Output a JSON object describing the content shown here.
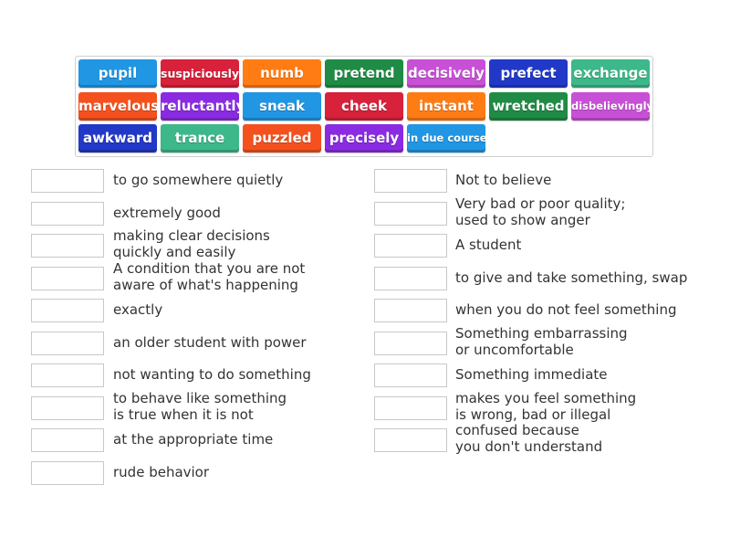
{
  "word_bank": [
    {
      "label": "pupil",
      "color": "#2196e3"
    },
    {
      "label": "suspiciously",
      "color": "#d8213b"
    },
    {
      "label": "numb",
      "color": "#ff7c14"
    },
    {
      "label": "pretend",
      "color": "#1f8b45"
    },
    {
      "label": "decisively",
      "color": "#c850d6"
    },
    {
      "label": "prefect",
      "color": "#2239c8"
    },
    {
      "label": "exchange",
      "color": "#3db88a"
    },
    {
      "label": "marvelous",
      "color": "#f4511e"
    },
    {
      "label": "reluctantly",
      "color": "#8a2be2"
    },
    {
      "label": "sneak",
      "color": "#2196e3"
    },
    {
      "label": "cheek",
      "color": "#d8213b"
    },
    {
      "label": "instant",
      "color": "#ff7c14"
    },
    {
      "label": "wretched",
      "color": "#1f8b45"
    },
    {
      "label": "disbelievingly",
      "color": "#c850d6"
    },
    {
      "label": "awkward",
      "color": "#2239c8"
    },
    {
      "label": "trance",
      "color": "#3db88a"
    },
    {
      "label": "puzzled",
      "color": "#f4511e"
    },
    {
      "label": "precisely",
      "color": "#8a2be2"
    },
    {
      "label": "in due course",
      "color": "#2196e3"
    }
  ],
  "left_clues": [
    "to go somewhere quietly",
    "extremely good",
    "making clear decisions\nquickly and easily",
    "A condition that you are not\naware of what's happening",
    "exactly",
    "an older student with power",
    "not wanting to do something",
    "to behave like something\nis true when it is not",
    "at the appropriate time",
    "rude behavior"
  ],
  "right_clues": [
    "Not to believe",
    "Very bad or poor quality;\nused to show anger",
    "A student",
    "to give and take something, swap",
    "when you do not feel something",
    "Something embarrassing\nor uncomfortable",
    "Something immediate",
    "makes you feel something\nis wrong, bad or illegal",
    "confused because\nyou don't understand"
  ]
}
